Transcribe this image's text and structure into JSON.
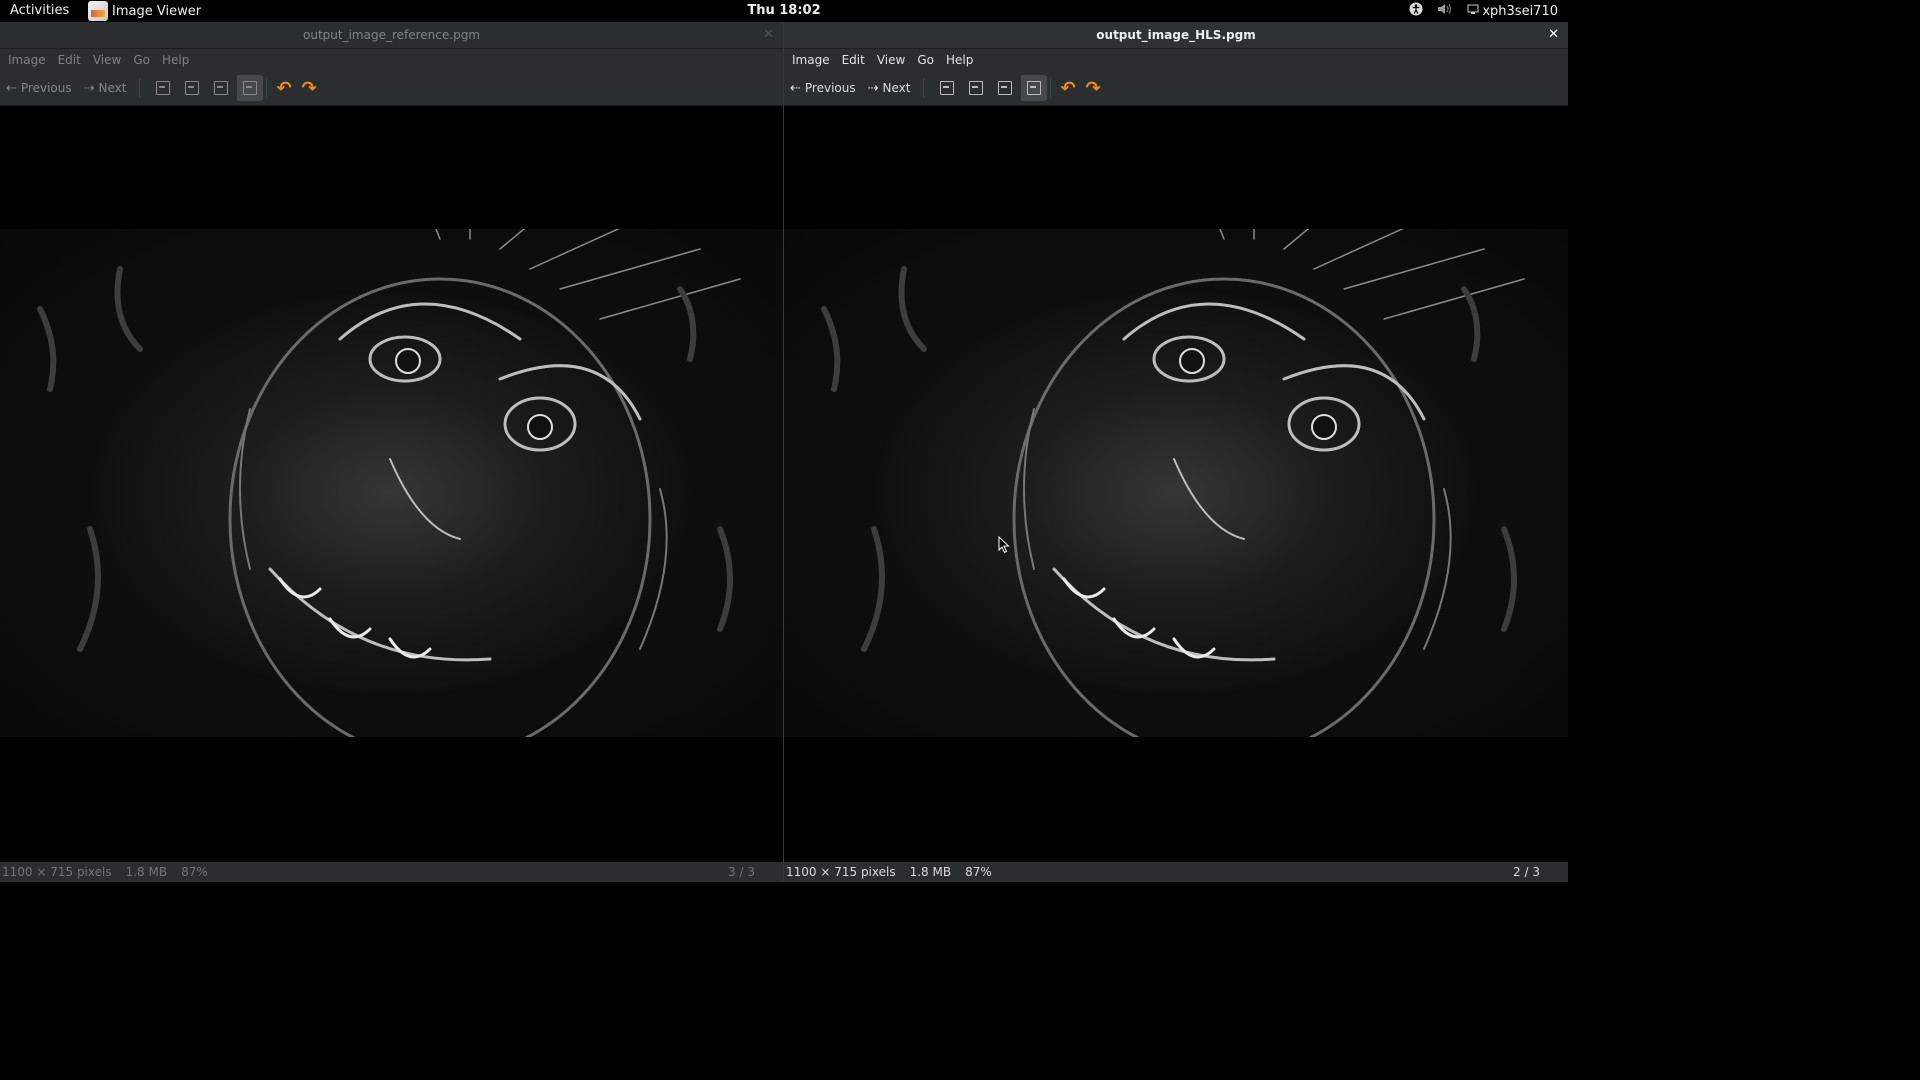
{
  "topbar": {
    "activities": "Activities",
    "app_name": "Image Viewer",
    "clock": "Thu 18:02",
    "user": "xph3sei710",
    "icons": [
      "accessibility-icon",
      "volume-icon",
      "network-icon"
    ]
  },
  "left_window": {
    "title": "output_image_reference.pgm",
    "menu": [
      "Image",
      "Edit",
      "View",
      "Go",
      "Help"
    ],
    "toolbar": {
      "previous": "Previous",
      "next": "Next"
    },
    "status": {
      "dimensions": "1100 × 715 pixels",
      "size": "1.8 MB",
      "zoom": "87%",
      "pager": "3 / 3"
    }
  },
  "right_window": {
    "title": "output_image_HLS.pgm",
    "menu": [
      "Image",
      "Edit",
      "View",
      "Go",
      "Help"
    ],
    "toolbar": {
      "previous": "Previous",
      "next": "Next"
    },
    "status": {
      "dimensions": "1100 × 715 pixels",
      "size": "1.8 MB",
      "zoom": "87%",
      "pager": "2 / 3"
    }
  },
  "colors": {
    "panel": "#2b2e2f",
    "rotate_accent": "#f08a1c"
  }
}
